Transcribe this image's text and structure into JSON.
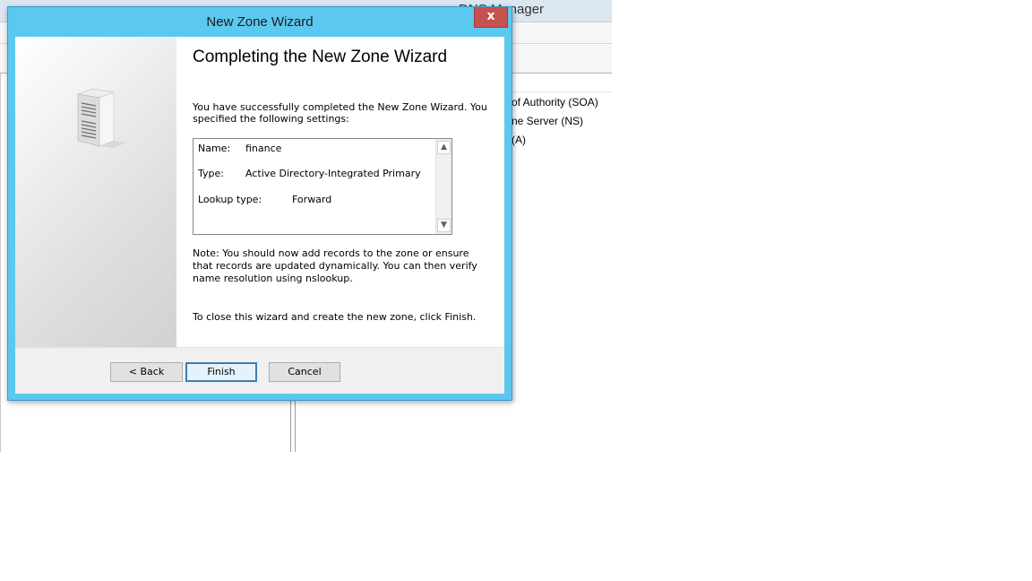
{
  "background_window": {
    "title": "DNS Manager",
    "records": [
      "of Authority (SOA)",
      "ne Server (NS)",
      "(A)"
    ]
  },
  "dialog": {
    "title": "New Zone Wizard",
    "close_label": "x",
    "heading": "Completing the New Zone Wizard",
    "intro": "You have successfully completed the New Zone Wizard. You specified the following settings:",
    "settings": [
      {
        "label": "Name:",
        "value": "finance"
      },
      {
        "label": "Type:",
        "value": "Active Directory-Integrated Primary"
      },
      {
        "label": "Lookup type:",
        "value": "Forward"
      }
    ],
    "note": "Note: You should now add records to the zone or ensure that records are updated dynamically. You can then verify name resolution using nslookup.",
    "close_instruction": "To close this wizard and create the new zone, click Finish.",
    "buttons": {
      "back": "< Back",
      "finish": "Finish",
      "cancel": "Cancel"
    }
  },
  "colors": {
    "dialog_frame": "#5bc8ef",
    "close_button": "#c75050",
    "default_button_border": "#3c7fb1"
  },
  "icons": {
    "scroll_up": "▲",
    "scroll_down": "▼"
  }
}
